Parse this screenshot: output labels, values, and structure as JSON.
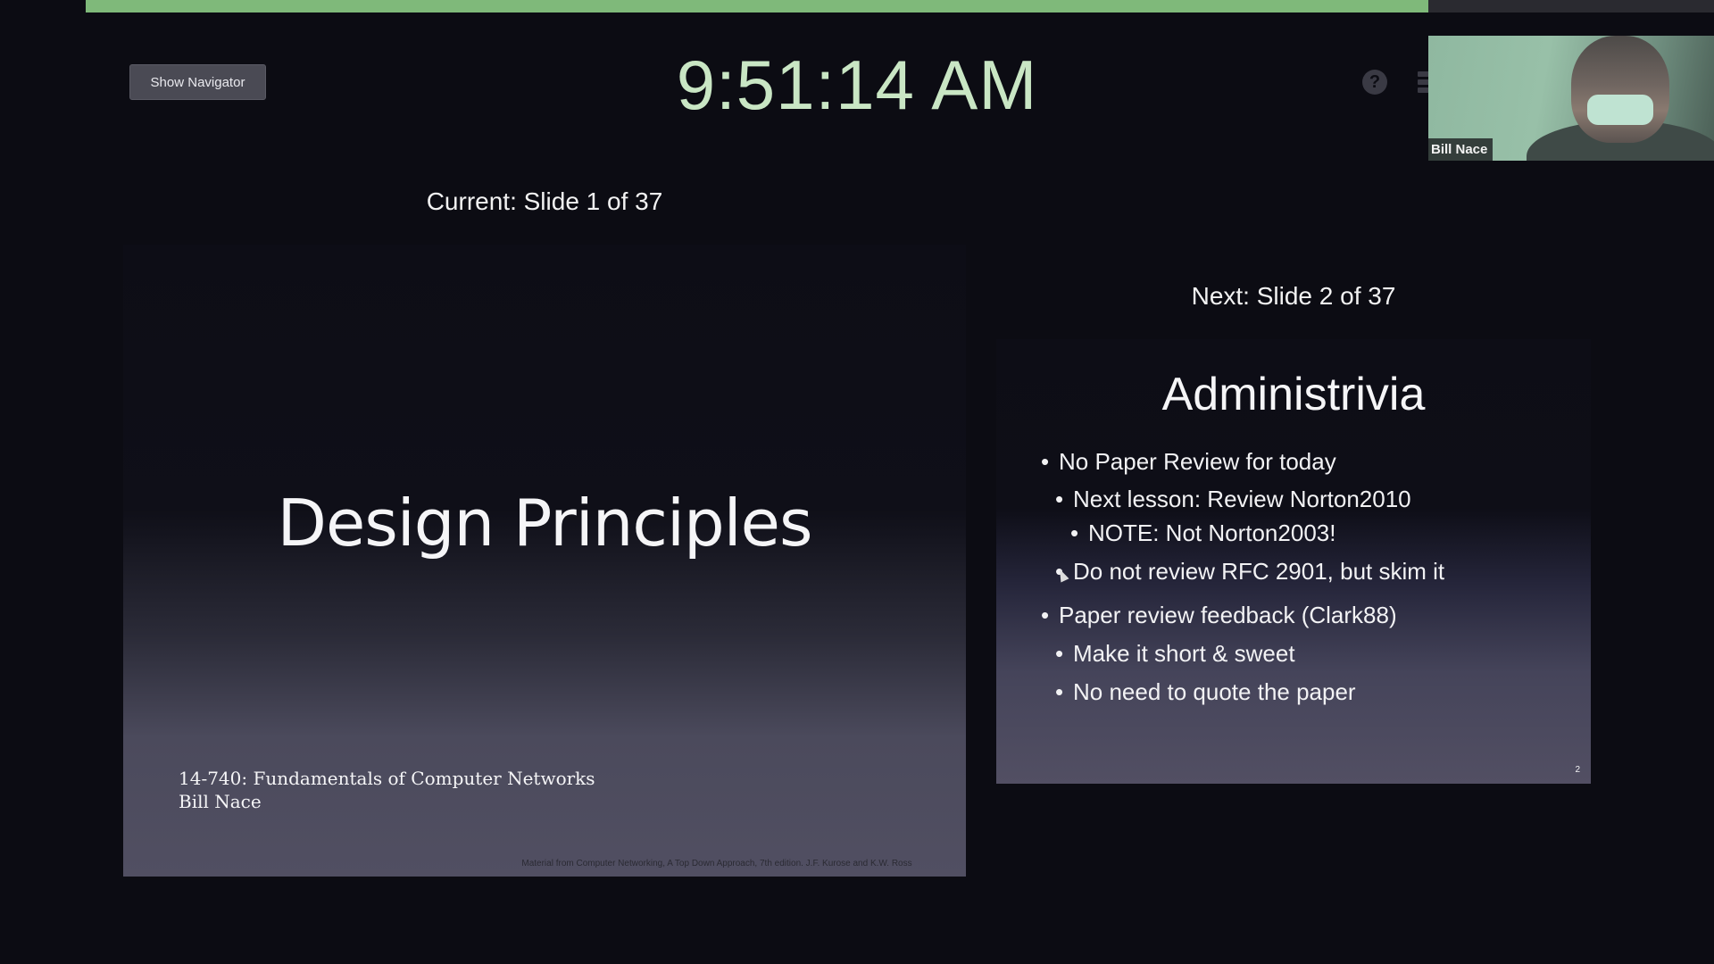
{
  "toolbar": {
    "show_navigator_label": "Show Navigator",
    "clock": "9:51:14 AM",
    "help_icon": "help-icon",
    "menu_icon": "menu-icon"
  },
  "colors": {
    "share_bar": "#7fb97a",
    "clock": "#c9e6c4",
    "background": "#0c0c13"
  },
  "video": {
    "participant_name": "Bill Nace"
  },
  "current": {
    "caption": "Current: Slide 1 of 37",
    "title": "Design Principles",
    "course_line1": "14-740: Fundamentals of Computer Networks",
    "course_line2": "Bill Nace",
    "credit": "Material from Computer Networking, A Top Down Approach, 7th edition.  J.F. Kurose and K.W. Ross"
  },
  "next": {
    "caption": "Next: Slide 2 of 37",
    "title": "Administrivia",
    "bullets": [
      {
        "level": 1,
        "text": "No Paper Review for today"
      },
      {
        "level": 2,
        "text": "Next lesson: Review Norton2010"
      },
      {
        "level": 3,
        "text": "NOTE: Not Norton2003!"
      },
      {
        "level": 2,
        "text": "Do not review RFC 2901, but skim it"
      },
      {
        "level": 1,
        "text": "Paper review feedback (Clark88)"
      },
      {
        "level": 2,
        "text": "Make it short & sweet"
      },
      {
        "level": 2,
        "text": "No need to quote the paper"
      }
    ],
    "page_number": "2"
  }
}
